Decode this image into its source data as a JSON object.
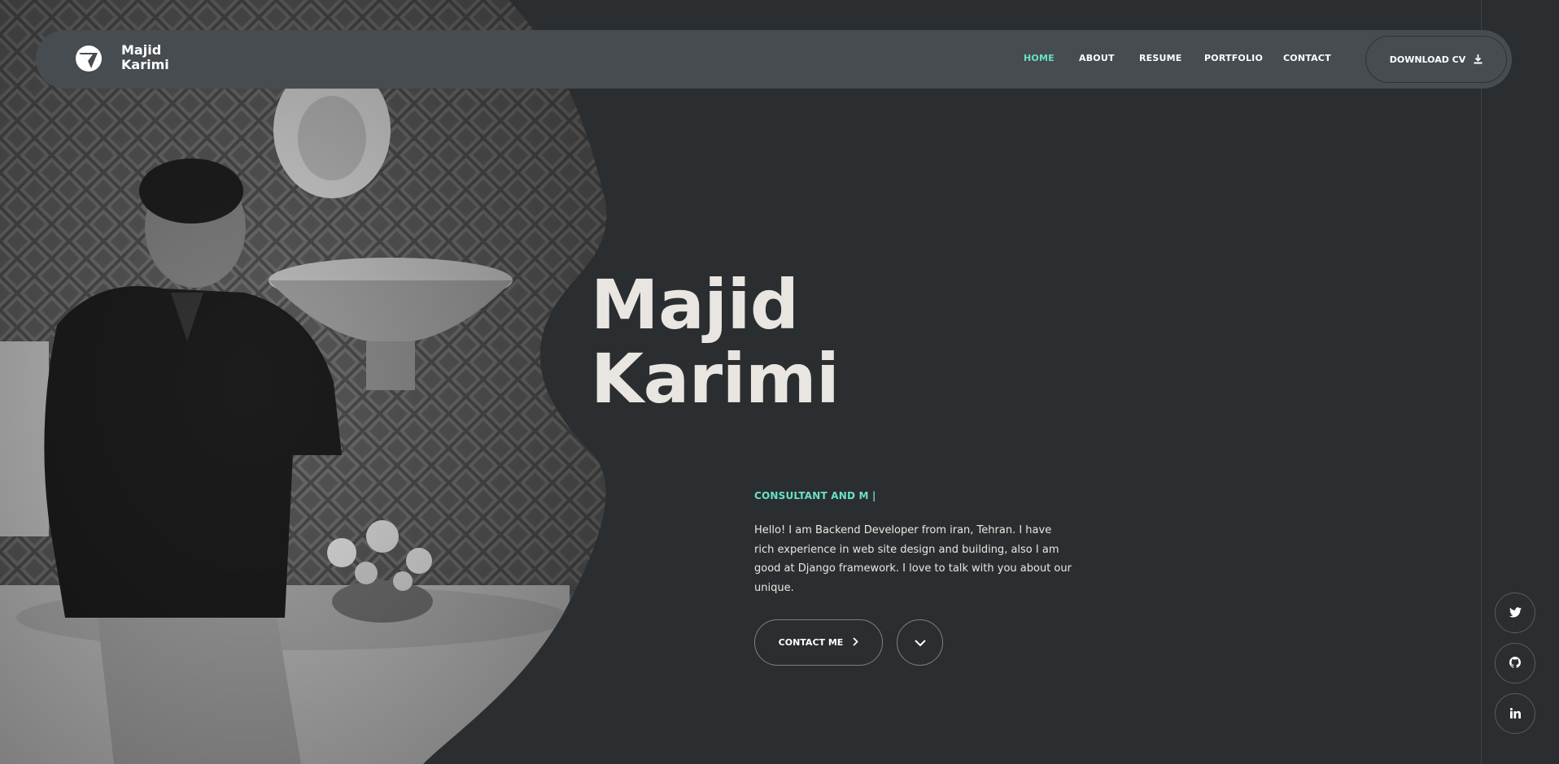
{
  "brand": {
    "first": "Majid",
    "last": "Karimi",
    "logo_icon": "bird-logo-icon"
  },
  "nav": {
    "items": [
      {
        "label": "HOME",
        "active": true
      },
      {
        "label": "ABOUT",
        "active": false
      },
      {
        "label": "RESUME",
        "active": false
      },
      {
        "label": "PORTFOLIO",
        "active": false
      },
      {
        "label": "CONTACT",
        "active": false
      }
    ],
    "download_cv": {
      "label": "DOWNLOAD CV",
      "icon": "download-icon"
    }
  },
  "hero": {
    "name_line1": "Majid",
    "name_line2": "Karimi",
    "tagline": "CONSULTANT AND M |",
    "intro": "Hello! I am Backend Developer from iran, Tehran. I have rich experience in web site design and building, also I am good at Django framework. I love to talk with you about our unique.",
    "contact_button": {
      "label": "CONTACT ME",
      "icon": "chevron-right-icon"
    },
    "scroll_button_icon": "chevron-down-icon"
  },
  "social": [
    {
      "name": "twitter",
      "icon": "twitter-icon"
    },
    {
      "name": "github",
      "icon": "github-icon"
    },
    {
      "name": "linkedin",
      "icon": "linkedin-icon"
    }
  ],
  "colors": {
    "background": "#2b2e30",
    "header": "#474c50",
    "accent": "#67e1c8",
    "text": "#e9e6e2"
  }
}
